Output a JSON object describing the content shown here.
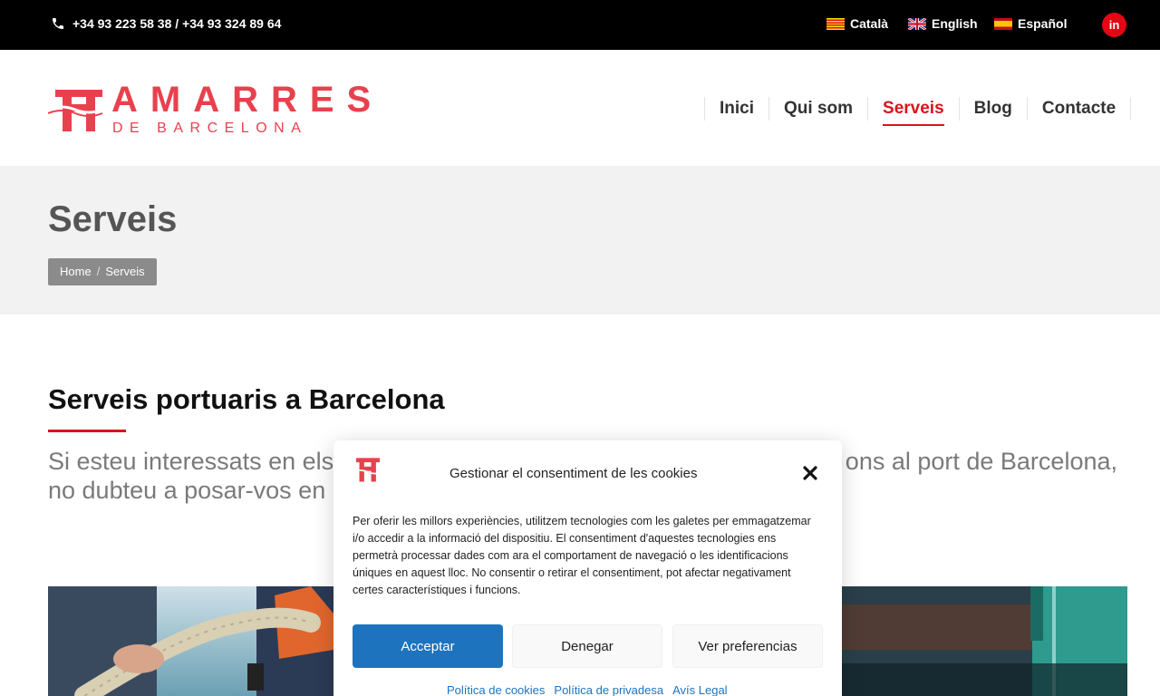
{
  "topbar": {
    "phone": "+34 93 223 58 38 / +34 93 324 89 64",
    "languages": [
      {
        "label": "Català",
        "icon": "catalan-flag-icon"
      },
      {
        "label": "English",
        "icon": "uk-flag-icon"
      },
      {
        "label": "Español",
        "icon": "spain-flag-icon"
      }
    ],
    "social": "in"
  },
  "header": {
    "logo_main": "AMARRES",
    "logo_sub": "DE BARCELONA",
    "nav": [
      "Inici",
      "Qui som",
      "Serveis",
      "Blog",
      "Contacte"
    ],
    "active_nav": "Serveis"
  },
  "titleband": {
    "title": "Serveis",
    "breadcrumb": [
      "Home",
      "Serveis"
    ],
    "breadcrumb_sep": "/"
  },
  "content": {
    "section_title": "Serveis portuaris a Barcelona",
    "intro_line1_left": "Si esteu interessats en els",
    "intro_line1_right": "ons al port de Barcelona,",
    "intro_line2_left": "no dubteu a posar-vos en"
  },
  "cookie_modal": {
    "title": "Gestionar el consentiment de les cookies",
    "body": "Per oferir les millors experiències, utilitzem tecnologies com les galetes per emmagatzemar i/o accedir a la informació del dispositiu. El consentiment d'aquestes tecnologies ens permetrà processar dades com ara el comportament de navegació o les identificacions úniques en aquest lloc. No consentir o retirar el consentiment, pot afectar negativament certes característiques i funcions.",
    "accept": "Acceptar",
    "deny": "Denegar",
    "preferences": "Ver preferencias",
    "links": [
      "Política de cookies",
      "Política de privadesa",
      "Avís Legal"
    ]
  },
  "colors": {
    "brand_red": "#d7141f",
    "accept_blue": "#1e73be",
    "topbar": "#000000"
  }
}
